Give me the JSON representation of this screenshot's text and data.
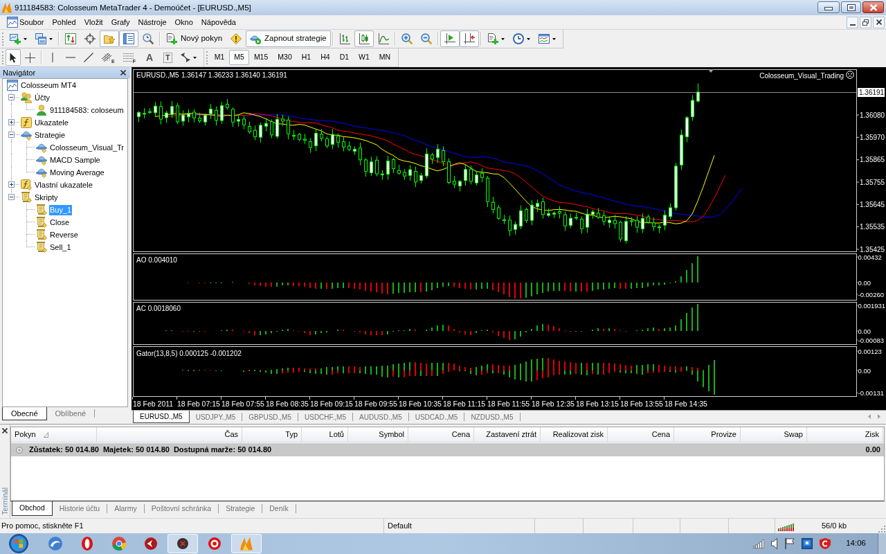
{
  "window": {
    "title": "911184583: Colosseum MetaTrader 4 - Demoúčet - [EURUSD.,M5]"
  },
  "menu": [
    "Soubor",
    "Pohled",
    "Vložit",
    "Grafy",
    "Nástroje",
    "Okno",
    "Nápověda"
  ],
  "toolbar_standard": [
    [
      {
        "pressed": false
      },
      {
        "pressed": false
      }
    ],
    [
      {
        "pressed": false
      },
      {
        "pressed": false
      },
      {
        "pressed": true
      },
      {
        "pressed": true
      },
      {
        "pressed": false
      }
    ],
    [
      {
        "label": "Nový pokyn",
        "pressed": false
      },
      {
        "pressed": false
      },
      {
        "label": "Zapnout strategie",
        "pressed": true
      }
    ],
    [
      {
        "pressed": false
      },
      {
        "pressed": true
      },
      {
        "pressed": false
      }
    ],
    [
      {
        "pressed": false
      },
      {
        "pressed": false
      }
    ],
    [
      {
        "pressed": true
      },
      {
        "pressed": true
      }
    ],
    [
      {
        "pressed": false
      },
      {
        "pressed": false
      },
      {
        "pressed": false
      }
    ]
  ],
  "toolbar_objects": [
    [
      {
        "pressed": true
      },
      {
        "pressed": false
      }
    ],
    [
      {
        "pressed": false
      },
      {
        "pressed": false
      },
      {
        "pressed": false
      },
      {
        "pressed": false,
        "glyph": "E"
      },
      {
        "pressed": false,
        "glyph": "F"
      },
      {
        "pressed": false,
        "glyph": "A"
      },
      {
        "pressed": false,
        "glyph": "T"
      },
      {
        "pressed": false
      }
    ]
  ],
  "periods": [
    {
      "label": "M1",
      "selected": false
    },
    {
      "label": "M5",
      "selected": true
    },
    {
      "label": "M15",
      "selected": false
    },
    {
      "label": "M30",
      "selected": false
    },
    {
      "label": "H1",
      "selected": false
    },
    {
      "label": "H4",
      "selected": false
    },
    {
      "label": "D1",
      "selected": false
    },
    {
      "label": "W1",
      "selected": false
    },
    {
      "label": "MN",
      "selected": false
    }
  ],
  "navigator": {
    "title": "Navigátor",
    "tree": [
      {
        "kind": "terminal",
        "label": "Colosseum MT4",
        "selected": false,
        "children": [
          {
            "kind": "accounts",
            "label": "Účty",
            "expanded": true,
            "selected": false,
            "children": [
              {
                "kind": "account",
                "label": "911184583: coloseum",
                "selected": false
              }
            ]
          },
          {
            "kind": "indicators",
            "label": "Ukazatele",
            "expanded": false,
            "selected": false
          },
          {
            "kind": "experts",
            "label": "Strategie",
            "expanded": true,
            "selected": false,
            "children": [
              {
                "kind": "expert",
                "label": "Colosseum_Visual_Tr",
                "selected": false
              },
              {
                "kind": "expert",
                "label": "MACD Sample",
                "selected": false
              },
              {
                "kind": "expert",
                "label": "Moving Average",
                "selected": false
              }
            ]
          },
          {
            "kind": "custom",
            "label": "Vlastní ukazatele",
            "expanded": false,
            "selected": false
          },
          {
            "kind": "scripts",
            "label": "Skripty",
            "expanded": true,
            "selected": false,
            "children": [
              {
                "kind": "script",
                "label": "Buy_1",
                "selected": true
              },
              {
                "kind": "script",
                "label": "Close",
                "selected": false
              },
              {
                "kind": "script",
                "label": "Reverse",
                "selected": false
              },
              {
                "kind": "script",
                "label": "Sell_1",
                "selected": false
              }
            ]
          }
        ]
      }
    ],
    "tabs": [
      {
        "label": "Obecné",
        "selected": true
      },
      {
        "label": "Oblíbené",
        "selected": false
      }
    ]
  },
  "chart": {
    "symbol": "EURUSD.,M5",
    "ohlc": "1.36147 1.36233 1.36140 1.36191",
    "expert": "Colosseum_Visual_Trading",
    "bid_price": "1.36191",
    "price_axis": [
      "1.36080",
      "1.35970",
      "1.35865",
      "1.35755",
      "1.35645",
      "1.35535",
      "1.35425"
    ],
    "indicators": [
      {
        "kind": "ao",
        "label": "AO 0.004010",
        "axis": [
          "0.00432",
          "0.00",
          "-0.00260"
        ]
      },
      {
        "kind": "ac",
        "label": "AC 0.0018060",
        "axis": [
          "0.001931",
          "0.00",
          "-0.00083"
        ]
      },
      {
        "kind": "gator",
        "label": "Gator(13,8,5) 0.000125 -0.001202",
        "axis": [
          "0.00123",
          "0.00",
          "-0.00131"
        ]
      }
    ],
    "time_axis": [
      "18 Feb 2011",
      "18 Feb 07:15",
      "18 Feb 07:55",
      "18 Feb 08:35",
      "18 Feb 09:15",
      "18 Feb 09:55",
      "18 Feb 10:35",
      "18 Feb 11:15",
      "18 Feb 11:55",
      "18 Feb 12:35",
      "18 Feb 13:15",
      "18 Feb 13:55",
      "18 Feb 14:35"
    ]
  },
  "chart_tabs": [
    {
      "label": "EURUSD.,M5",
      "selected": true
    },
    {
      "label": "USDJPY.,M5",
      "selected": false
    },
    {
      "label": "GBPUSD.,M5",
      "selected": false
    },
    {
      "label": "USDCHF.,M5",
      "selected": false
    },
    {
      "label": "AUDUSD.,M5",
      "selected": false
    },
    {
      "label": "USDCAD.,M5",
      "selected": false
    },
    {
      "label": "NZDUSD.,M5",
      "selected": false
    }
  ],
  "terminal": {
    "title": "Terminál",
    "columns": [
      {
        "label": "Pokyn",
        "sorted": true
      },
      {
        "label": "Čas",
        "sorted": false
      },
      {
        "label": "Typ",
        "sorted": false
      },
      {
        "label": "Lotů",
        "sorted": false
      },
      {
        "label": "Symbol",
        "sorted": false
      },
      {
        "label": "Cena",
        "sorted": false
      },
      {
        "label": "Zastavení ztrát",
        "sorted": false
      },
      {
        "label": "Realizovat zisk",
        "sorted": false
      },
      {
        "label": "Cena",
        "sorted": false
      },
      {
        "label": "Provize",
        "sorted": false
      },
      {
        "label": "Swap",
        "sorted": false
      },
      {
        "label": "Zisk",
        "sorted": false
      }
    ],
    "summary": [
      "Zůstatek: 50 014.80",
      "Majetek: 50 014.80",
      "Dostupná marže: 50 014.80"
    ],
    "profit": "0.00",
    "tabs": [
      {
        "label": "Obchod",
        "selected": true
      },
      {
        "label": "Historie účtu",
        "selected": false
      },
      {
        "label": "Alarmy",
        "selected": false
      },
      {
        "label": "Poštovní schránka",
        "selected": false
      },
      {
        "label": "Strategie",
        "selected": false
      },
      {
        "label": "Deník",
        "selected": false
      }
    ]
  },
  "status_bar": {
    "help": "Pro pomoc, stiskněte F1",
    "profile": "Default",
    "traffic": "56/0 kb"
  },
  "taskbar": {
    "apps": [
      {
        "running": false
      },
      {
        "running": false
      },
      {
        "running": false
      },
      {
        "running": false
      },
      {
        "running": true
      },
      {
        "running": false
      },
      {
        "running": true
      }
    ],
    "clock": "14:06"
  }
}
